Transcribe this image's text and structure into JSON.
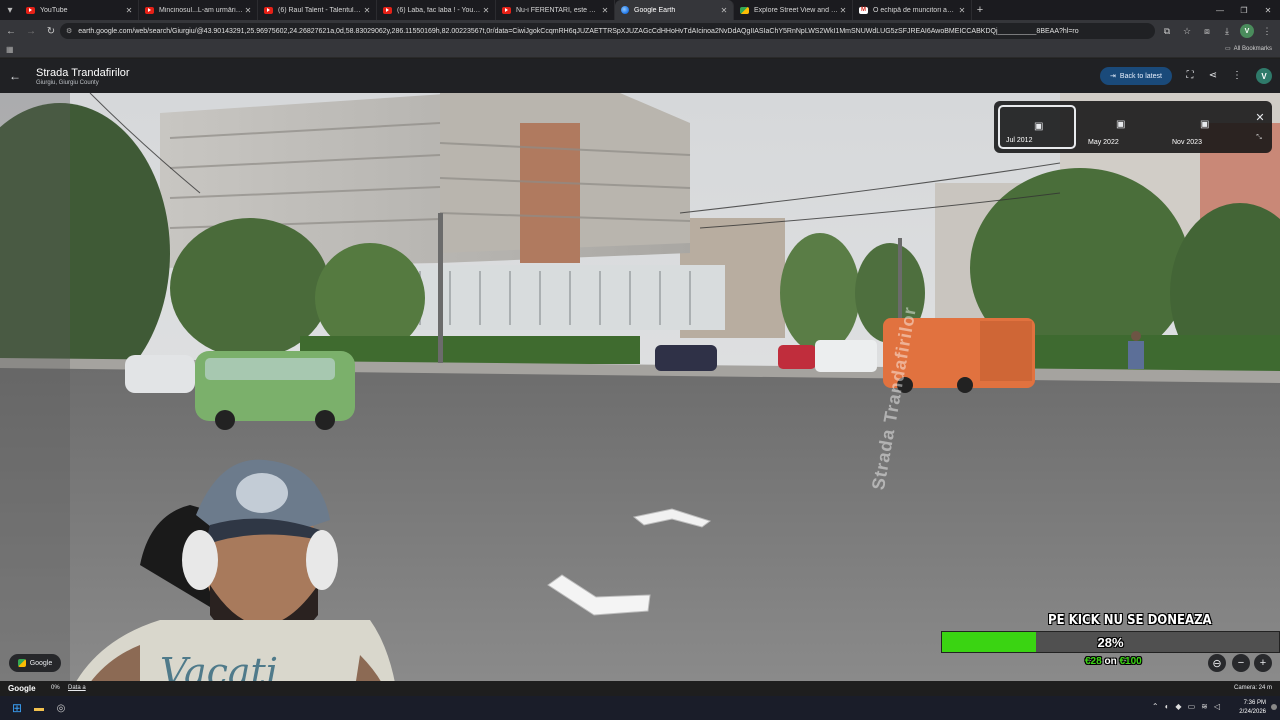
{
  "browser": {
    "tabs": [
      {
        "title": "YouTube",
        "favicon": "youtube-icon",
        "active": false
      },
      {
        "title": "Mincinosul...L-am urmărit două",
        "favicon": "youtube-icon",
        "active": false
      },
      {
        "title": "(6) Raul Talent - Talentul ala fin",
        "favicon": "youtube-icon",
        "active": false
      },
      {
        "title": "(6) Laba, fac laba ! - YouTube",
        "favicon": "youtube-icon",
        "active": false
      },
      {
        "title": "Nu-i FERENTARI, este TEI TOBO",
        "favicon": "youtube-icon",
        "active": false
      },
      {
        "title": "Google Earth",
        "favicon": "google-earth-icon",
        "active": true
      },
      {
        "title": "Explore Street View and add yo",
        "favicon": "street-view-icon",
        "active": false
      },
      {
        "title": "O echipă de muncitori au dărâ",
        "favicon": "gmail-icon",
        "active": false
      }
    ],
    "url": "earth.google.com/web/search/Giurgiu/@43.90143291,25.96975602,24.26827621a,0d,58.83029062y,286.11550169h,82.00223567t,0r/data=CiwiJgokCcqmRH6qJUZAETTRSpXJUZAGcCdHHoHvTdAIcinoa2NvDdAQgIIASIaChY5RnNpLWS2WkI1MmSNUWdLUG5zSFJREAI6AwoBMEICCABKDQj__________8BEAA?hl=ro",
    "all_bookmarks": "All Bookmarks",
    "profile_initial": "V"
  },
  "earth": {
    "place_title": "Strada Trandafirilor",
    "place_subtitle": "Giurgiu, Giurgiu County",
    "back_to_latest": "Back to latest",
    "avatar_initial": "V",
    "time_machine": [
      {
        "label": "Jul 2012",
        "selected": true
      },
      {
        "label": "May 2022",
        "selected": false
      },
      {
        "label": "Nov 2023",
        "selected": false
      }
    ],
    "street_name_painted": "Strada Trandafirilor",
    "google_chip": "Google",
    "status": {
      "logo": "Google",
      "percent": "0%",
      "data_link": "Data a",
      "camera": "Camera: 24 m"
    }
  },
  "overlay": {
    "donation_title": "PE KICK NU SE DONEAZA",
    "donation_percent_text": "28%",
    "donation_fraction": 0.28,
    "donation_current": "€28",
    "donation_on": " on ",
    "donation_goal": "€100",
    "bar_color": "#3ad412"
  },
  "taskbar": {
    "time": "7:36 PM",
    "date": "2/24/2026"
  }
}
